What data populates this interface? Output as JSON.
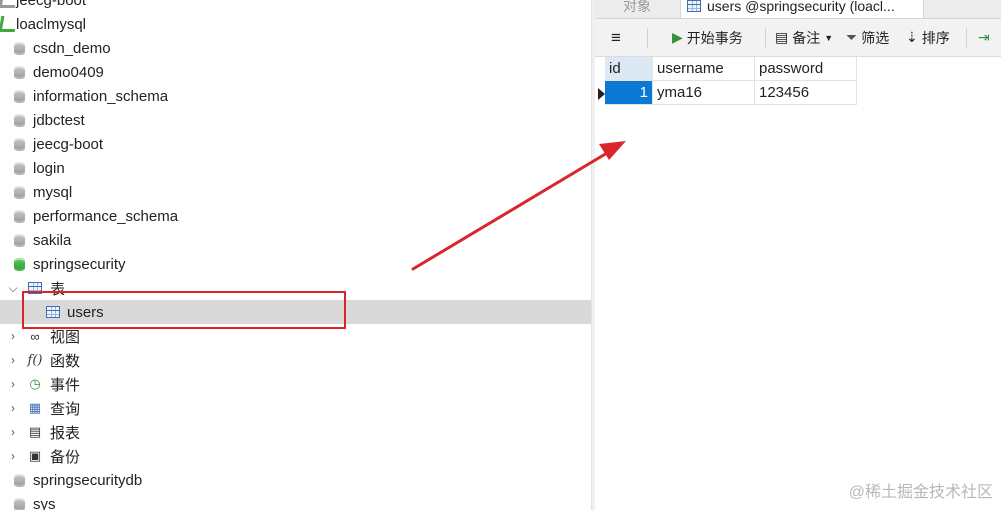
{
  "tree": {
    "items": [
      {
        "label": "jeecg-boot",
        "icon": "connection-icon"
      },
      {
        "label": "loaclmysql",
        "icon": "connection-icon"
      },
      {
        "label": "csdn_demo",
        "icon": "database-icon"
      },
      {
        "label": "demo0409",
        "icon": "database-icon"
      },
      {
        "label": "information_schema",
        "icon": "database-icon"
      },
      {
        "label": "jdbctest",
        "icon": "database-icon"
      },
      {
        "label": "jeecg-boot",
        "icon": "database-icon"
      },
      {
        "label": "login",
        "icon": "database-icon"
      },
      {
        "label": "mysql",
        "icon": "database-icon"
      },
      {
        "label": "performance_schema",
        "icon": "database-icon"
      },
      {
        "label": "sakila",
        "icon": "database-icon"
      },
      {
        "label": "springsecurity",
        "icon": "database-open-icon"
      },
      {
        "label": "表",
        "icon": "tables-icon"
      },
      {
        "label": "users",
        "icon": "table-icon"
      },
      {
        "label": "视图",
        "icon": "views-icon"
      },
      {
        "label": "函数",
        "icon": "function-icon"
      },
      {
        "label": "事件",
        "icon": "event-icon"
      },
      {
        "label": "查询",
        "icon": "query-icon"
      },
      {
        "label": "报表",
        "icon": "report-icon"
      },
      {
        "label": "备份",
        "icon": "backup-icon"
      },
      {
        "label": "springsecuritydb",
        "icon": "database-icon"
      },
      {
        "label": "sys",
        "icon": "database-icon"
      }
    ]
  },
  "tabs": {
    "objects": "对象",
    "users": "users @springsecurity (loacl..."
  },
  "toolbar": {
    "begin_transaction": "开始事务",
    "memo": "备注",
    "filter": "筛选",
    "sort": "排序"
  },
  "grid": {
    "columns": [
      "id",
      "username",
      "password"
    ],
    "rows": [
      [
        "1",
        "yma16",
        "123456"
      ]
    ]
  },
  "watermark": "@稀土掘金技术社区",
  "colors": {
    "highlight": "#d9262c",
    "selection": "#0a78d4",
    "selected_row": "#d9d9d9"
  }
}
